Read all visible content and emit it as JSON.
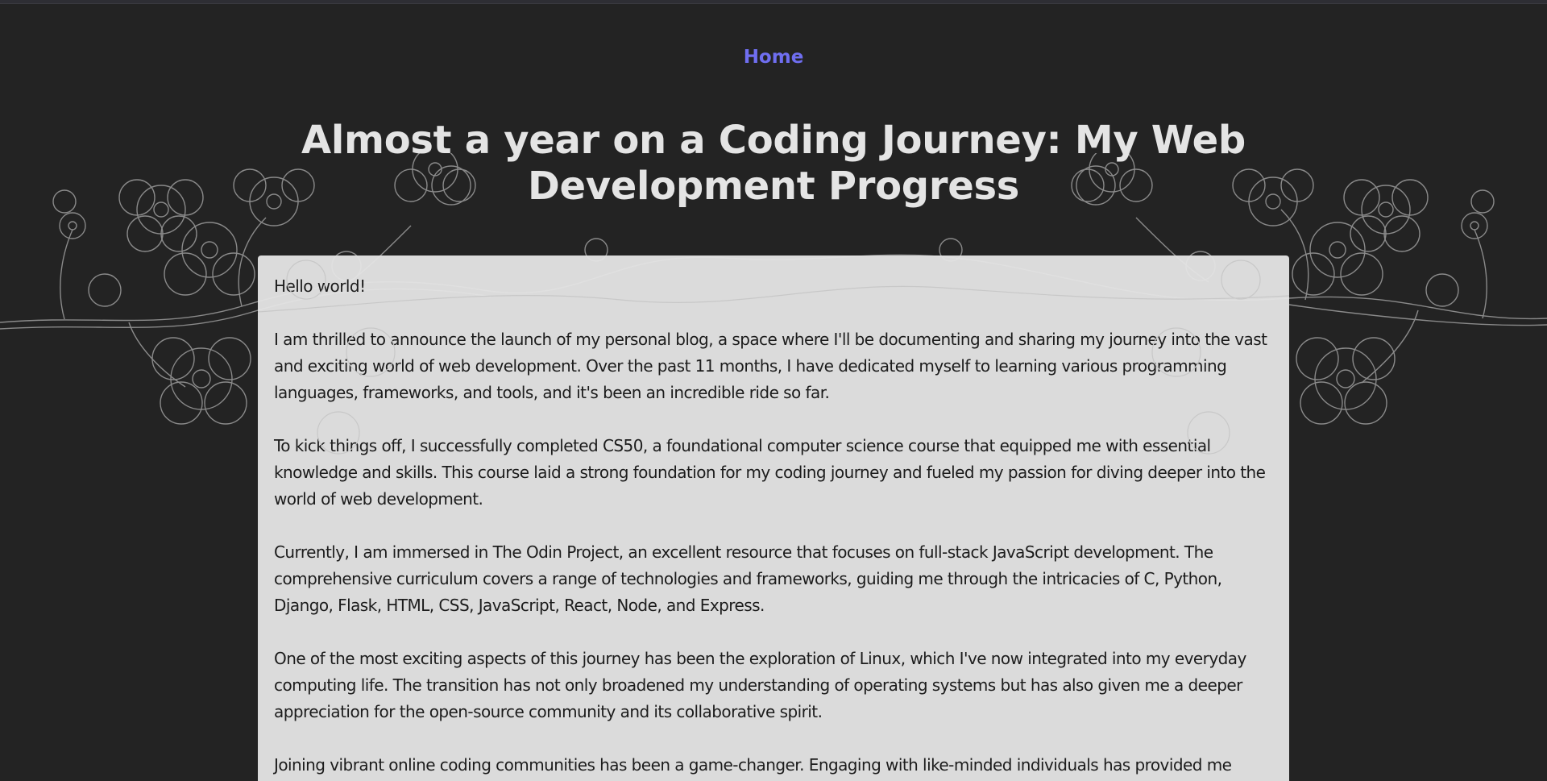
{
  "nav": {
    "home_label": "Home"
  },
  "post": {
    "title": "Almost a year on a Coding Journey: My Web Development Progress",
    "paragraphs": [
      "Hello world!",
      "I am thrilled to announce the launch of my personal blog, a space where I'll be documenting and sharing my journey into the vast and exciting world of web development. Over the past 11 months, I have dedicated myself to learning various programming languages, frameworks, and tools, and it's been an incredible ride so far.",
      "To kick things off, I successfully completed CS50, a foundational computer science course that equipped me with essential knowledge and skills. This course laid a strong foundation for my coding journey and fueled my passion for diving deeper into the world of web development.",
      "Currently, I am immersed in The Odin Project, an excellent resource that focuses on full-stack JavaScript development. The comprehensive curriculum covers a range of technologies and frameworks, guiding me through the intricacies of C, Python, Django, Flask, HTML, CSS, JavaScript, React, Node, and Express.",
      "One of the most exciting aspects of this journey has been the exploration of Linux, which I've now integrated into my everyday computing life. The transition has not only broadened my understanding of operating systems but has also given me a deeper appreciation for the open-source community and its collaborative spirit.",
      "Joining vibrant online coding communities has been a game-changer. Engaging with like-minded individuals has provided me"
    ]
  },
  "colors": {
    "background": "#232323",
    "nav_link": "#6f6ef0",
    "title_text": "#e4e4e4",
    "content_bg": "#e4e4e4",
    "content_text": "#1c1c1c",
    "floral_line": "#8a8a8a"
  },
  "icons": {
    "background_decoration": "cherry-blossom-branch-illustration"
  }
}
